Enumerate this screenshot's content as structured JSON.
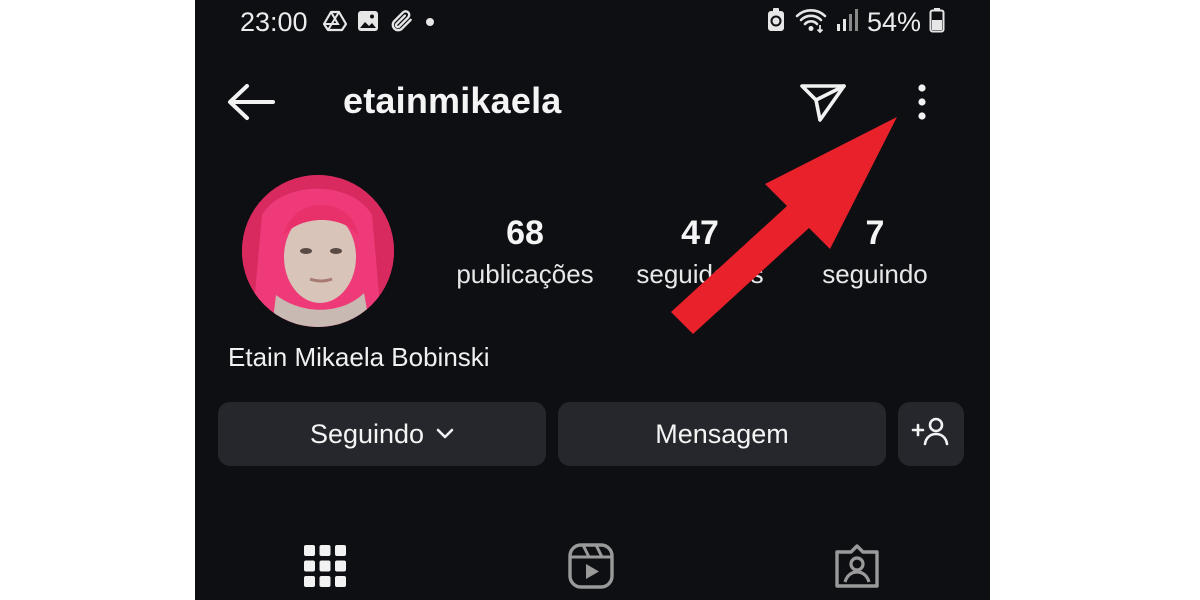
{
  "status_bar": {
    "time": "23:00",
    "battery_percent": "54%",
    "left_icons": [
      "drive-icon",
      "gallery-icon",
      "paperclip-icon",
      "dot-icon"
    ],
    "right_icons": [
      "battery-saver-icon",
      "wifi-icon",
      "signal-icon",
      "battery-icon"
    ]
  },
  "header": {
    "username": "etainmikaela",
    "icons": [
      "back-arrow-icon",
      "send-icon",
      "more-options-icon"
    ]
  },
  "profile": {
    "full_name": "Etain Mikaela Bobinski",
    "stats": [
      {
        "value": "68",
        "label": "publicações"
      },
      {
        "value": "47",
        "label": "seguidores"
      },
      {
        "value": "7",
        "label": "seguindo"
      }
    ]
  },
  "actions": {
    "following_label": "Seguindo",
    "message_label": "Mensagem"
  },
  "tabs": [
    "grid-icon",
    "reels-icon",
    "tagged-icon"
  ],
  "colors": {
    "background": "#0d0f13",
    "button_bg": "#25272c",
    "annotation_arrow": "#e8212b",
    "avatar_hair": "#e8306a"
  }
}
